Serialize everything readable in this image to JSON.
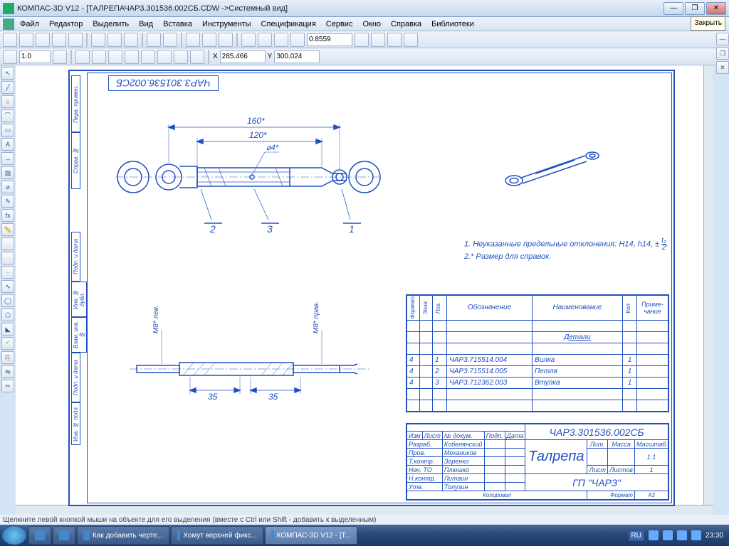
{
  "window": {
    "title": "КОМПАС-3D V12 - [ТАЛРЕПАЧАР3.301536.002СБ.CDW ->Системный вид]",
    "close_tooltip": "Закрыть"
  },
  "menu": {
    "file": "Файл",
    "editor": "Редактор",
    "select": "Выделить",
    "view": "Вид",
    "insert": "Вставка",
    "tools": "Инструменты",
    "spec": "Спецификация",
    "service": "Сервис",
    "window": "Окно",
    "help": "Справка",
    "libs": "Библиотеки"
  },
  "toolbar3": {
    "scale": "1.0",
    "zoom": "0.8559",
    "x": "285.466",
    "y": "300.024"
  },
  "drawing": {
    "part_no_rot": "ЧАР3.301536.002СБ",
    "dim_160": "160*",
    "dim_120": "120*",
    "dim_phi4": "⌀4*",
    "dim_35a": "35",
    "dim_35b": "35",
    "thread_left": "M8* лев.",
    "thread_right": "M8* прав.",
    "callout_1": "1",
    "callout_2": "2",
    "callout_3": "3",
    "note1": "1. Неуказанные предельные отклонения: H14, h14, ±",
    "note1_frac_t": "t₂",
    "note1_frac_b": "2",
    "note1_end": ".",
    "note2": "2.* Размер для справок."
  },
  "spec": {
    "h_format": "Формат",
    "h_zone": "Зона",
    "h_pos": "Поз.",
    "h_desig": "Обозначение",
    "h_name": "Наименование",
    "h_qty": "Кол.",
    "h_note": "Приме-\nчание",
    "section": "Детали",
    "rows": [
      {
        "fmt": "4",
        "pos": "1",
        "desig": "ЧАР3.715514.004",
        "name": "Вилка",
        "qty": "1"
      },
      {
        "fmt": "4",
        "pos": "2",
        "desig": "ЧАР3.715514.005",
        "name": "Петля",
        "qty": "1"
      },
      {
        "fmt": "4",
        "pos": "3",
        "desig": "ЧАР3.712362.003",
        "name": "Втулка",
        "qty": "1"
      }
    ]
  },
  "titleblock": {
    "part_no": "ЧАР3.301536.002СБ",
    "name": "Талрепа",
    "org": "ГП \"ЧАРЗ\"",
    "h_izm": "Изм",
    "h_list": "Лист",
    "h_ndoc": "№ докум.",
    "h_podp": "Подп.",
    "h_data": "Дата",
    "r_razrab": "Разраб.",
    "v_razrab": "Кобелянский",
    "r_prov": "Пров.",
    "v_prov": "Механиков",
    "r_tkontr": "Т.контр.",
    "v_tkontr": "Зоренко",
    "r_nach": "Нач. ТО",
    "v_nach": "Плюшко",
    "r_nkontr": "Н.контр.",
    "v_nkontr": "Литвин",
    "r_utv": "Утв.",
    "v_utv": "Толузин",
    "h_lit": "Лит.",
    "h_massa": "Масса",
    "h_masht": "Масштаб",
    "v_masht": "1:1",
    "h_list2": "Лист",
    "h_listov": "Листов",
    "v_listov": "1",
    "kopiroval": "Копировал",
    "format": "Формат",
    "format_v": "А3"
  },
  "leftstamp": {
    "c1": "Перв. примен.",
    "c2": "Справ. №",
    "c3": "Подп. и дата",
    "c4": "Инв. № дубл.",
    "c5": "Взам. инв. №",
    "c6": "Подп. и дата",
    "c7": "Инв. № подл."
  },
  "status": {
    "text": "Щелкните левой кнопкой мыши на объекте для его выделения (вместе с Ctrl или Shift - добавить к выделенным)"
  },
  "taskbar": {
    "t1": "Как добавить черте...",
    "t2": "Хомут верхней фикс...",
    "t3": "КОМПАС-3D V12 - [Т...",
    "lang": "RU",
    "time": "23:30"
  }
}
